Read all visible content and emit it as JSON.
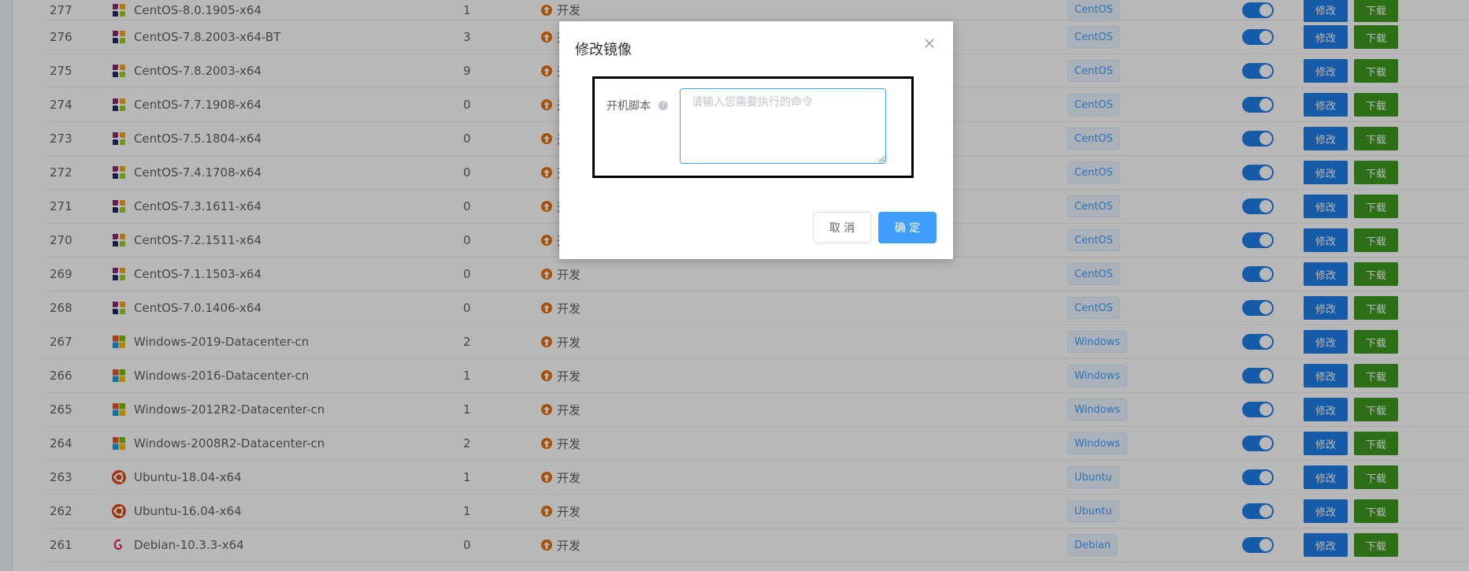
{
  "table": {
    "rows": [
      {
        "id": "277",
        "name": "CentOS-8.0.1905-x64",
        "os_icon": "centos-icon",
        "count": "1",
        "status": "开发",
        "tag": "CentOS",
        "edit_label": "修改",
        "download_label": "下载"
      },
      {
        "id": "276",
        "name": "CentOS-7.8.2003-x64-BT",
        "os_icon": "centos-icon",
        "count": "3",
        "status": "开发",
        "tag": "CentOS",
        "edit_label": "修改",
        "download_label": "下载"
      },
      {
        "id": "275",
        "name": "CentOS-7.8.2003-x64",
        "os_icon": "centos-icon",
        "count": "9",
        "status": "开发",
        "tag": "CentOS",
        "edit_label": "修改",
        "download_label": "下载"
      },
      {
        "id": "274",
        "name": "CentOS-7.7.1908-x64",
        "os_icon": "centos-icon",
        "count": "0",
        "status": "开发",
        "tag": "CentOS",
        "edit_label": "修改",
        "download_label": "下载"
      },
      {
        "id": "273",
        "name": "CentOS-7.5.1804-x64",
        "os_icon": "centos-icon",
        "count": "0",
        "status": "开发",
        "tag": "CentOS",
        "edit_label": "修改",
        "download_label": "下载"
      },
      {
        "id": "272",
        "name": "CentOS-7.4.1708-x64",
        "os_icon": "centos-icon",
        "count": "0",
        "status": "开发",
        "tag": "CentOS",
        "edit_label": "修改",
        "download_label": "下载"
      },
      {
        "id": "271",
        "name": "CentOS-7.3.1611-x64",
        "os_icon": "centos-icon",
        "count": "0",
        "status": "开发",
        "tag": "CentOS",
        "edit_label": "修改",
        "download_label": "下载"
      },
      {
        "id": "270",
        "name": "CentOS-7.2.1511-x64",
        "os_icon": "centos-icon",
        "count": "0",
        "status": "开发",
        "tag": "CentOS",
        "edit_label": "修改",
        "download_label": "下载"
      },
      {
        "id": "269",
        "name": "CentOS-7.1.1503-x64",
        "os_icon": "centos-icon",
        "count": "0",
        "status": "开发",
        "tag": "CentOS",
        "edit_label": "修改",
        "download_label": "下载"
      },
      {
        "id": "268",
        "name": "CentOS-7.0.1406-x64",
        "os_icon": "centos-icon",
        "count": "0",
        "status": "开发",
        "tag": "CentOS",
        "edit_label": "修改",
        "download_label": "下载"
      },
      {
        "id": "267",
        "name": "Windows-2019-Datacenter-cn",
        "os_icon": "windows-icon",
        "count": "2",
        "status": "开发",
        "tag": "Windows",
        "edit_label": "修改",
        "download_label": "下载"
      },
      {
        "id": "266",
        "name": "Windows-2016-Datacenter-cn",
        "os_icon": "windows-icon",
        "count": "1",
        "status": "开发",
        "tag": "Windows",
        "edit_label": "修改",
        "download_label": "下载"
      },
      {
        "id": "265",
        "name": "Windows-2012R2-Datacenter-cn",
        "os_icon": "windows-icon",
        "count": "1",
        "status": "开发",
        "tag": "Windows",
        "edit_label": "修改",
        "download_label": "下载"
      },
      {
        "id": "264",
        "name": "Windows-2008R2-Datacenter-cn",
        "os_icon": "windows-icon",
        "count": "2",
        "status": "开发",
        "tag": "Windows",
        "edit_label": "修改",
        "download_label": "下载"
      },
      {
        "id": "263",
        "name": "Ubuntu-18.04-x64",
        "os_icon": "ubuntu-icon",
        "count": "1",
        "status": "开发",
        "tag": "Ubuntu",
        "edit_label": "修改",
        "download_label": "下载"
      },
      {
        "id": "262",
        "name": "Ubuntu-16.04-x64",
        "os_icon": "ubuntu-icon",
        "count": "1",
        "status": "开发",
        "tag": "Ubuntu",
        "edit_label": "修改",
        "download_label": "下载"
      },
      {
        "id": "261",
        "name": "Debian-10.3.3-x64",
        "os_icon": "debian-icon",
        "count": "0",
        "status": "开发",
        "tag": "Debian",
        "edit_label": "修改",
        "download_label": "下载"
      }
    ]
  },
  "dialog": {
    "title": "修改镜像",
    "field_label": "开机脚本",
    "help_icon": "question-icon",
    "input_placeholder": "请输入您需要执行的命令",
    "input_value": "",
    "cancel_label": "取 消",
    "confirm_label": "确 定"
  },
  "colors": {
    "primary": "#409eff",
    "edit_button": "#1e7ee8",
    "download_button": "#3e9a1f",
    "status_arrow": "#e6700c"
  }
}
